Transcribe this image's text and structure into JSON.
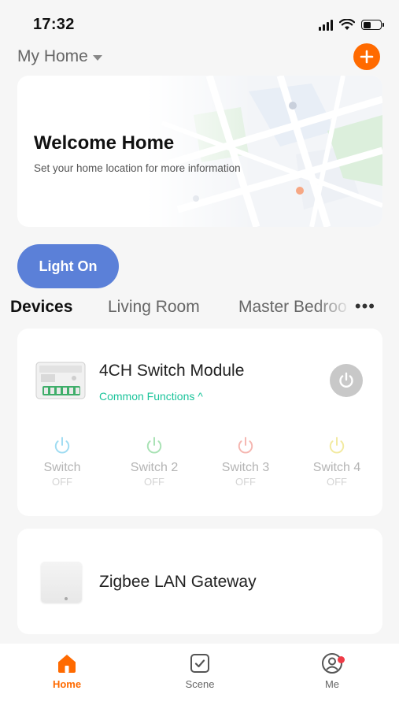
{
  "status_bar": {
    "time": "17:32",
    "battery_level": 0.45
  },
  "header": {
    "home_name": "My Home",
    "add_icon": "plus-icon",
    "accent_color": "#ff6a00"
  },
  "welcome": {
    "title": "Welcome Home",
    "subtitle": "Set your home location for more information"
  },
  "scene_button": {
    "label": "Light On",
    "color": "#5b80d8"
  },
  "rooms": {
    "tabs": [
      {
        "label": "Devices",
        "active": true
      },
      {
        "label": "Living Room",
        "active": false
      },
      {
        "label": "Master Bedroo",
        "active": false
      }
    ],
    "more": "•••"
  },
  "devices": [
    {
      "name": "4CH Switch Module",
      "subtitle": "Common Functions ^",
      "switches": [
        {
          "label": "Switch",
          "state": "OFF",
          "color": "#9fdcf2"
        },
        {
          "label": "Switch 2",
          "state": "OFF",
          "color": "#a8e2b4"
        },
        {
          "label": "Switch 3",
          "state": "OFF",
          "color": "#f5b6b0"
        },
        {
          "label": "Switch 4",
          "state": "OFF",
          "color": "#f2eaa0"
        }
      ]
    },
    {
      "name": "Zigbee LAN Gateway"
    }
  ],
  "bottom_nav": [
    {
      "label": "Home",
      "icon": "home-icon",
      "active": true
    },
    {
      "label": "Scene",
      "icon": "scene-icon",
      "active": false
    },
    {
      "label": "Me",
      "icon": "profile-icon",
      "active": false,
      "notification": true
    }
  ]
}
